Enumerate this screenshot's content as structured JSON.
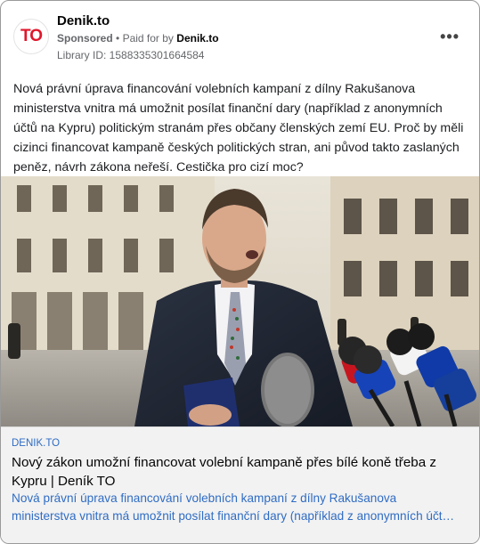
{
  "header": {
    "avatar_text": "TO",
    "page_name": "Denik.to",
    "sponsored_label": "Sponsored",
    "paid_for_by_prefix": "Paid for by",
    "paid_for_by_name": "Denik.to",
    "library_id": "Library ID: 1588335301664584",
    "menu_icon": "more-horizontal-icon"
  },
  "post": {
    "text": "Nová právní úprava financování volebních kampaní z dílny Rakušanova ministerstva vnitra má umožnit posílat finanční dary (například z anonymních účtů na Kypru) politickým stranám přes občany členských zemí EU. Proč by měli cizinci financovat kampaně českých politických stran, ani původ takto zaslaných peněz, návrh zákona neřeší. Cestička pro cizí moc?"
  },
  "link": {
    "domain": "DENIK.TO",
    "title": "Nový zákon umožní financovat volební kampaně přes bílé koně třeba z Kypru | Deník TO",
    "desc_line1": "Nová právní úprava financování volebních kampaní z dílny Rakušanova",
    "desc_line2": "ministerstva vnitra má umožnit posílat finanční dary (například z anonymních účt…"
  },
  "colors": {
    "brand_red": "#e0162b",
    "link_blue": "#2f6cc4"
  }
}
